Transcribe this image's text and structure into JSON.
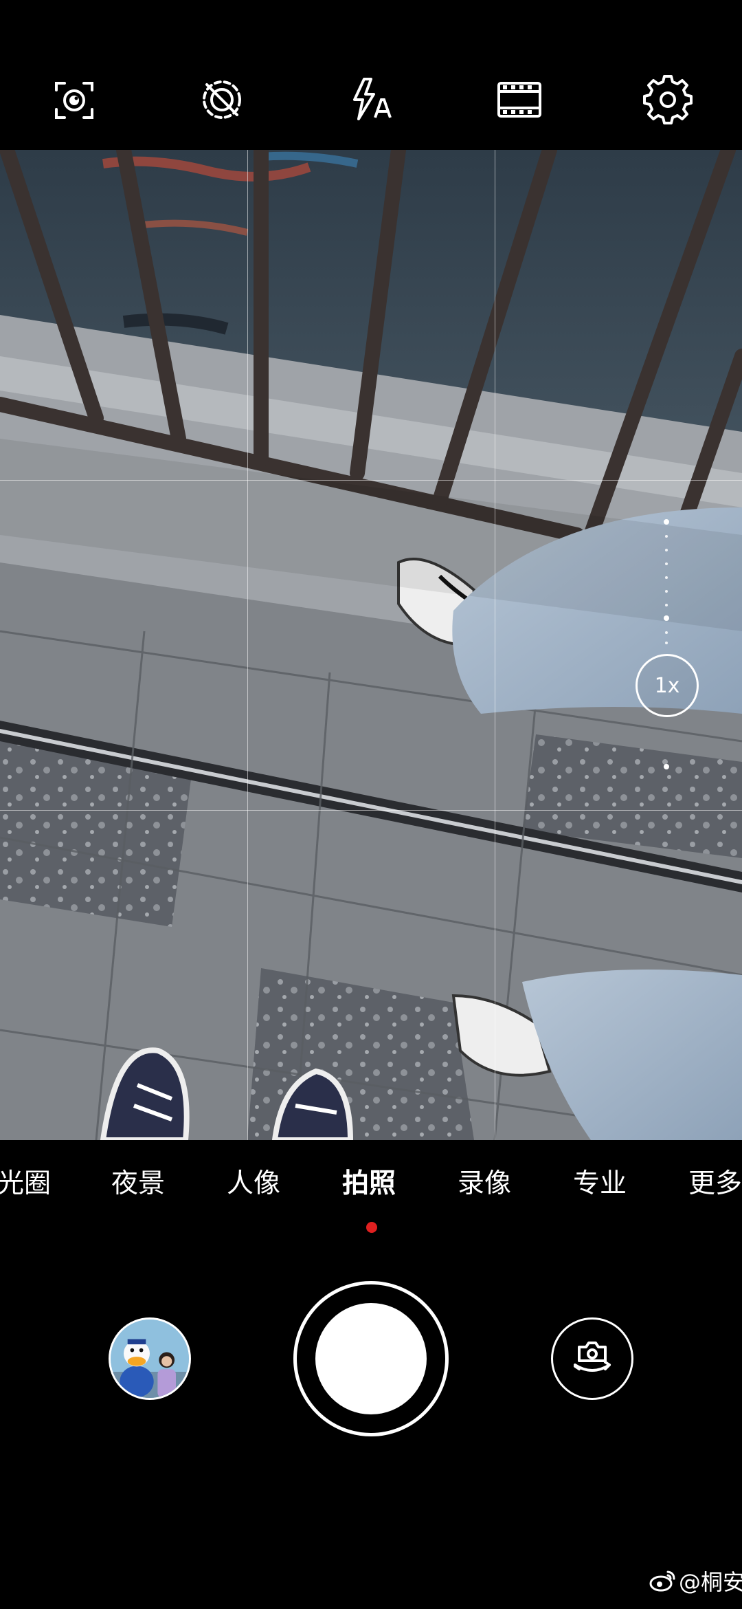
{
  "top_bar": {
    "buttons": [
      {
        "name": "ai-scene-icon"
      },
      {
        "name": "motion-photo-off-icon"
      },
      {
        "name": "flash-auto-icon"
      },
      {
        "name": "aspect-ratio-icon"
      },
      {
        "name": "settings-icon"
      }
    ]
  },
  "viewfinder": {
    "zoom_label": "1x"
  },
  "modes": {
    "items": [
      {
        "label": "光圈"
      },
      {
        "label": "夜景"
      },
      {
        "label": "人像"
      },
      {
        "label": "拍照"
      },
      {
        "label": "录像"
      },
      {
        "label": "专业"
      },
      {
        "label": "更多"
      }
    ],
    "active": "拍照",
    "indicator_color": "#e02020"
  },
  "controls": {
    "gallery": "gallery-thumbnail",
    "shutter": "shutter-button",
    "switch": "switch-camera-icon"
  },
  "watermark": {
    "text": "@桐安"
  }
}
